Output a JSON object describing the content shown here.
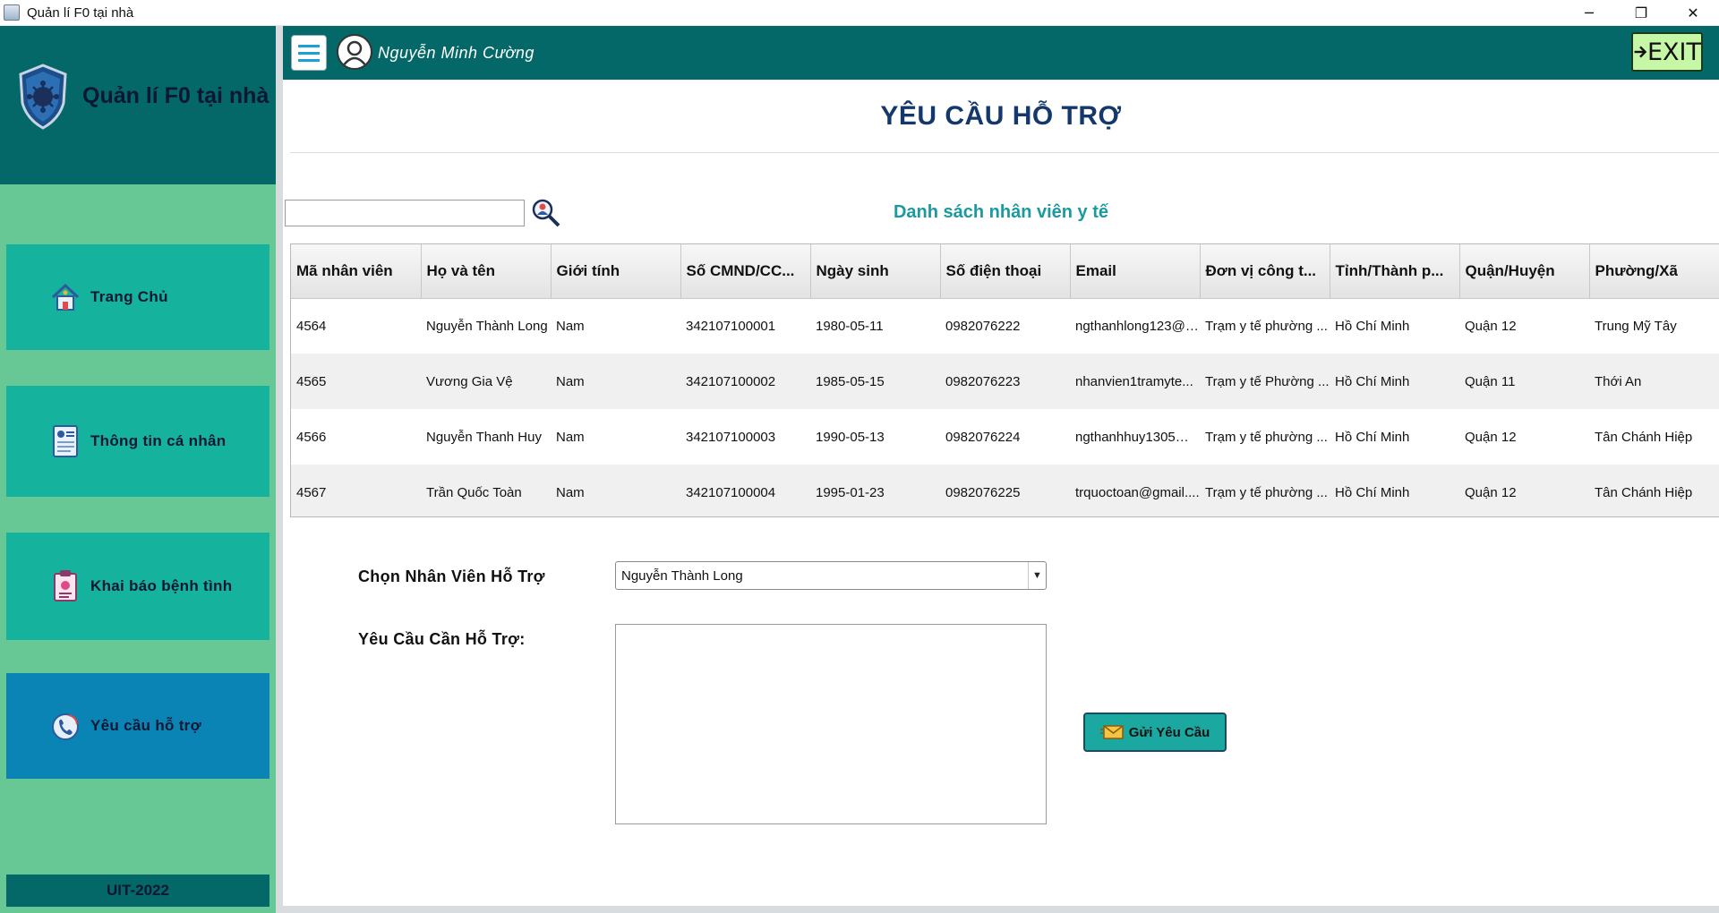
{
  "window": {
    "title": "Quản lí F0 tại nhà",
    "minimize_glyph": "─",
    "restore_glyph": "❐",
    "close_glyph": "✕"
  },
  "sidebar": {
    "app_title": "Quản lí F0 tại nhà",
    "items": [
      {
        "label": "Trang Chủ",
        "icon": "home-icon"
      },
      {
        "label": "Thông tin cá nhân",
        "icon": "profile-document-icon"
      },
      {
        "label": "Khai báo bệnh tình",
        "icon": "medical-report-icon"
      },
      {
        "label": "Yêu cầu hỗ trợ",
        "icon": "support-call-icon"
      }
    ],
    "footer": "UIT-2022"
  },
  "topbar": {
    "user_name": "Nguyễn Minh Cường",
    "exit_label": "EXIT"
  },
  "page": {
    "title": "YÊU CẦU HỖ TRỢ",
    "list_title": "Danh sách nhân viên y tế",
    "search_placeholder": ""
  },
  "table": {
    "columns": [
      "Mã nhân viên",
      "Họ và tên",
      "Giới tính",
      "Số CMND/CC...",
      "Ngày sinh",
      "Số điện thoại",
      "Email",
      "Đơn vị công t...",
      "Tỉnh/Thành p...",
      "Quận/Huyện",
      "Phường/Xã"
    ],
    "rows": [
      [
        "4564",
        "Nguyễn Thành Long",
        "Nam",
        "342107100001",
        "1980-05-11",
        "0982076222",
        "ngthanhlong123@g...",
        "Trạm y tế phường ...",
        "Hồ Chí Minh",
        "Quận 12",
        "Trung Mỹ Tây"
      ],
      [
        "4565",
        "Vương Gia Vệ",
        "Nam",
        "342107100002",
        "1985-05-15",
        "0982076223",
        "nhanvien1tramyte...",
        "Trạm y tế Phường ...",
        "Hồ Chí Minh",
        "Quận 11",
        "Thới An"
      ],
      [
        "4566",
        "Nguyễn Thanh Huy",
        "Nam",
        "342107100003",
        "1990-05-13",
        "0982076224",
        "ngthanhhuy1305@...",
        "Trạm y tế phường ...",
        "Hồ Chí Minh",
        "Quận 12",
        "Tân Chánh Hiệp"
      ],
      [
        "4567",
        "Trần Quốc Toàn",
        "Nam",
        "342107100004",
        "1995-01-23",
        "0982076225",
        "trquoctoan@gmail....",
        "Trạm y tế phường ...",
        "Hồ Chí Minh",
        "Quận 12",
        "Tân Chánh Hiệp"
      ]
    ]
  },
  "form": {
    "select_label": "Chọn Nhân Viên Hỗ Trợ",
    "selected_staff": "Nguyễn Thành Long",
    "dropdown_arrow": "▼",
    "request_label": "Yêu Cầu Cần Hỗ Trợ:",
    "request_value": "",
    "send_label": "Gửi Yêu Cầu"
  },
  "colors": {
    "header_teal": "#056868",
    "sidebar_green": "#67c896",
    "menu_teal": "#15b29d",
    "menu_active": "#0a84b5",
    "title_navy": "#14386b",
    "list_title_teal": "#1a9aa0"
  }
}
